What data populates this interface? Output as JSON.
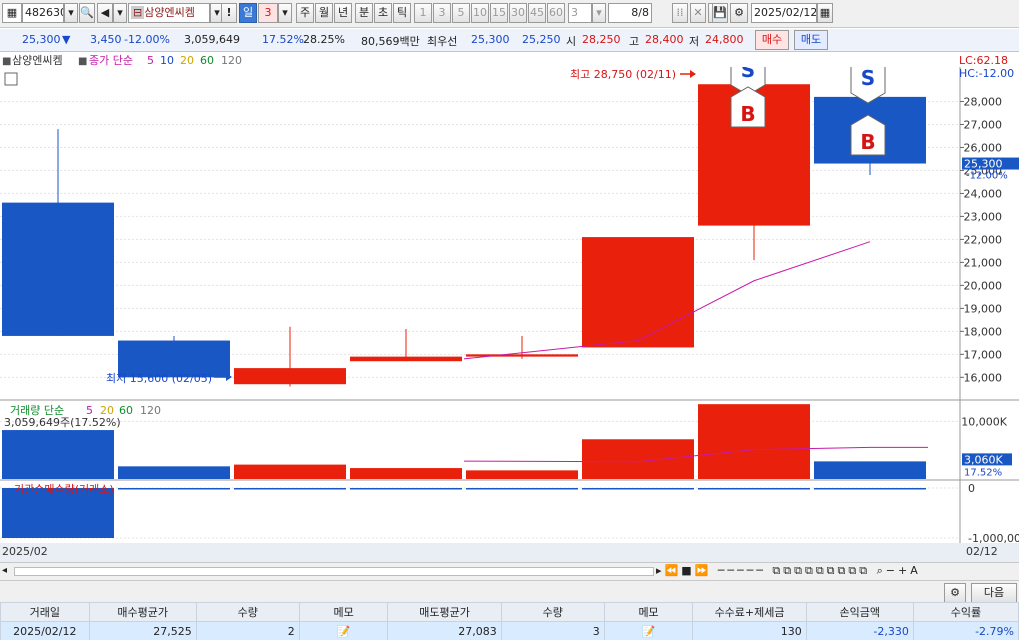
{
  "toolbar": {
    "code": "482630",
    "stock_name": "삼양엔씨켐",
    "period_buttons": [
      "일",
      "3",
      "주",
      "월",
      "년",
      "분",
      "초",
      "틱"
    ],
    "interval_buttons": [
      "1",
      "3",
      "5",
      "10",
      "15",
      "30",
      "45",
      "60"
    ],
    "interval_select": "3",
    "page": "8/8",
    "date": "2025/02/12"
  },
  "quote": {
    "price": "25,300",
    "change": "3,450",
    "change_rate": "-12.00%",
    "volume": "3,059,649",
    "vol_rate": "17.52%",
    "turnover": "28.25%",
    "amount": "80,569백만",
    "best_label": "최우선",
    "best_ask": "25,300",
    "best_bid": "25,250",
    "open_label": "시",
    "open": "28,250",
    "high_label": "고",
    "high": "28,400",
    "low_label": "저",
    "low": "24,800",
    "buy_label": "매수",
    "sell_label": "매도"
  },
  "chart_labels": {
    "stock_tag": "삼양엔씨켐",
    "ma_label": "종가 단순",
    "ma_periods": [
      "5",
      "10",
      "20",
      "60",
      "120"
    ],
    "lc": "LC:62.18",
    "hc": "HC:-12.00",
    "high_note": "최고 28,750 (02/11)",
    "low_note": "최저 15,600 (02/05)",
    "price_tag": "25,300",
    "price_tag_pct": "-12.00%",
    "vol_title": "거래량 단순",
    "vol_periods": [
      "5",
      "20",
      "60",
      "120"
    ],
    "vol_value": "3,059,649주(17.52%)",
    "vol_tag": "3,060K",
    "vol_tag_pct": "17.52%",
    "inst_title": "기관순매수량(거래소)",
    "x_start": "2025/02",
    "x_end": "02/12",
    "signal_s": "S",
    "signal_b": "B"
  },
  "colors": {
    "up": "#e8200c",
    "down": "#1957c4",
    "ma": "#c81aa8",
    "grid": "#e4e4e4"
  },
  "chart_data": {
    "type": "candlestick",
    "price": {
      "yticks": [
        16000,
        17000,
        18000,
        19000,
        20000,
        21000,
        22000,
        23000,
        24000,
        25000,
        26000,
        27000,
        28000
      ],
      "ytick_labels": [
        "16,000",
        "17,000",
        "18,000",
        "19,000",
        "20,000",
        "21,000",
        "22,000",
        "23,000",
        "24,000",
        "25,000",
        "26,000",
        "27,000",
        "28,000"
      ],
      "ylim": [
        15100,
        29500
      ],
      "candles": [
        {
          "open": 23600,
          "close": 17800,
          "high": 26800,
          "low": 17800
        },
        {
          "open": 17600,
          "close": 16000,
          "high": 17800,
          "low": 16000
        },
        {
          "open": 15700,
          "close": 16400,
          "high": 18200,
          "low": 15600
        },
        {
          "open": 16700,
          "close": 16900,
          "high": 18100,
          "low": 16700
        },
        {
          "open": 16900,
          "close": 17000,
          "high": 17800,
          "low": 16800
        },
        {
          "open": 17300,
          "close": 22100,
          "high": 22100,
          "low": 17300
        },
        {
          "open": 22600,
          "close": 28750,
          "high": 28750,
          "low": 21100
        },
        {
          "open": 28200,
          "close": 25300,
          "high": 28400,
          "low": 24800
        }
      ],
      "ma5": [
        null,
        null,
        null,
        null,
        16800,
        17600,
        20200,
        21900
      ]
    },
    "volume": {
      "yticks": [
        10000
      ],
      "ytick_labels": [
        "10,000K"
      ],
      "ylim": [
        0,
        13200
      ],
      "values": [
        8500,
        2200,
        2500,
        1900,
        1500,
        6900,
        13000,
        3060
      ],
      "up": [
        false,
        false,
        true,
        true,
        true,
        true,
        true,
        false
      ],
      "ma5": [
        null,
        null,
        null,
        null,
        3100,
        3000,
        5100,
        5500
      ]
    },
    "institution": {
      "yticks": [
        0,
        -1000000
      ],
      "ytick_labels": [
        "0",
        "-1,000,000"
      ],
      "ylim": [
        -1100000,
        100000
      ],
      "values": [
        -1000000,
        -5000,
        -3000,
        -2000,
        -2000,
        -5000,
        -8000,
        -5000
      ]
    }
  },
  "trade_table": {
    "headers": [
      "거래일",
      "매수평균가",
      "수량",
      "메모",
      "매도평균가",
      "수량",
      "메모",
      "수수료+제세금",
      "손익금액",
      "수익률"
    ],
    "row": [
      "2025/02/12",
      "27,525",
      "2",
      "",
      "27,083",
      "3",
      "",
      "130",
      "-2,330",
      "-2.79%"
    ]
  },
  "bottom": {
    "next_label": "다음"
  }
}
